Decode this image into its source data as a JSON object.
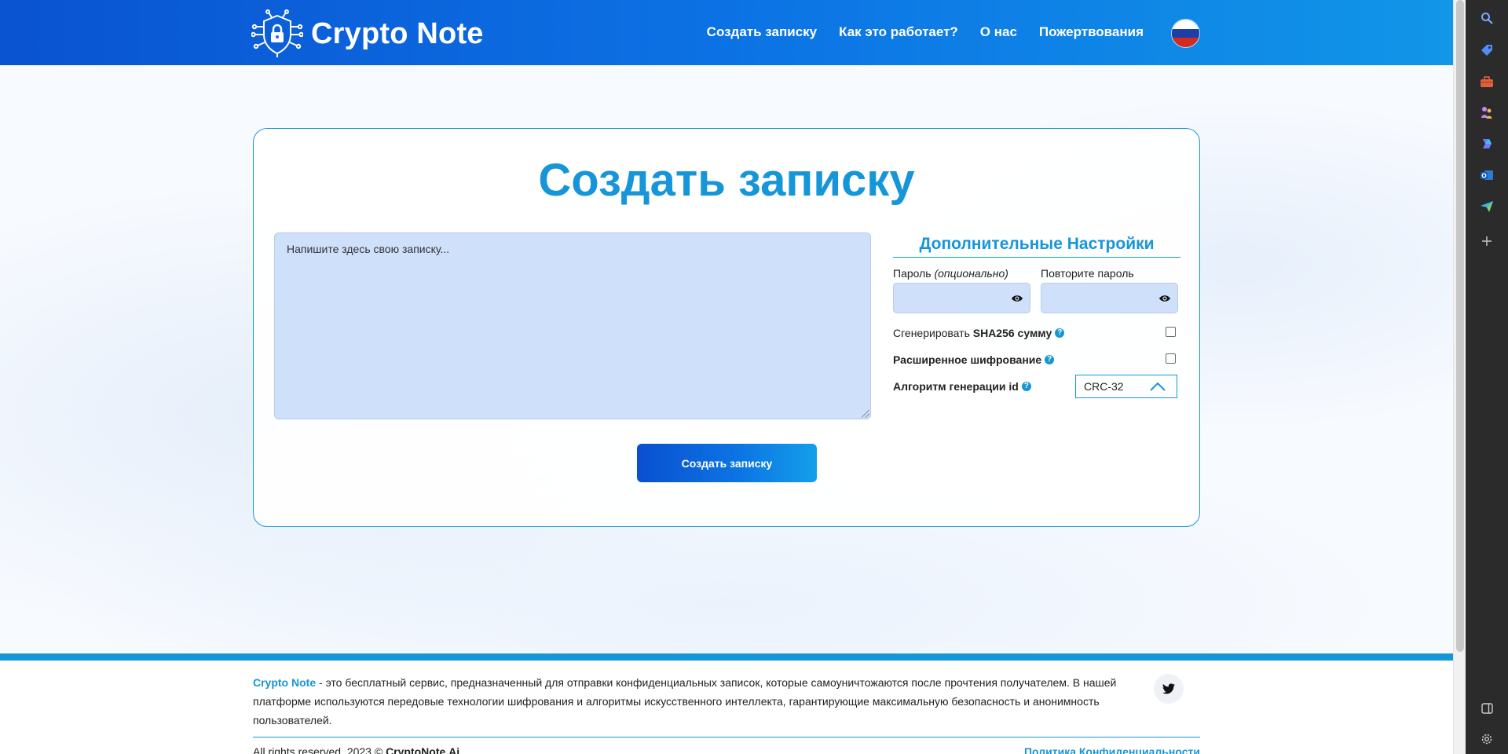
{
  "header": {
    "brand": "Crypto Note",
    "nav": [
      "Создать записку",
      "Как это работает?",
      "О нас",
      "Пожертвования"
    ],
    "language_flag": "russia-flag-icon"
  },
  "card": {
    "title": "Создать записку",
    "note_placeholder": "Напишите здесь свою записку...",
    "create_button": "Создать записку"
  },
  "settings": {
    "title": "Дополнительные Настройки",
    "password_label": "Пароль",
    "password_label_optional": "(опционально)",
    "repeat_password_label": "Повторите пароль",
    "sha_prefix": "Сгенерировать",
    "sha_bold": "SHA256 сумму",
    "advanced_encryption": "Расширенное шифрование",
    "id_algorithm_label": "Алгоритм генерации id",
    "id_algorithm_value": "CRC-32",
    "help_glyph": "?"
  },
  "footer": {
    "brand": "Crypto Note",
    "description": " - это бесплатный сервис, предназначенный для отправки конфиденциальных записок, которые самоуничтожаются после прочтения получателем. В нашей платформе используются передовые технологии шифрования и алгоритмы искусственного интеллекта, гарантирующие максимальную безопасность и анонимность пользователей.",
    "rights_prefix": "All rights reserved. 2023 ©",
    "rights_brand": "CryptoNote.Ai",
    "privacy_link": "Политика Конфиденциальности",
    "social_icon": "twitter-icon"
  },
  "colors": {
    "accent": "#1596d6",
    "header_start": "#0a53d1",
    "header_end": "#1196e8",
    "input_bg": "#cfe0fb"
  },
  "edge_sidebar": {
    "icons": [
      "search-icon",
      "tag-icon",
      "toolbox-icon",
      "chess-icon",
      "copilot-icon",
      "outlook-icon",
      "send-icon",
      "add-icon",
      "split-view-icon",
      "settings-icon"
    ]
  }
}
